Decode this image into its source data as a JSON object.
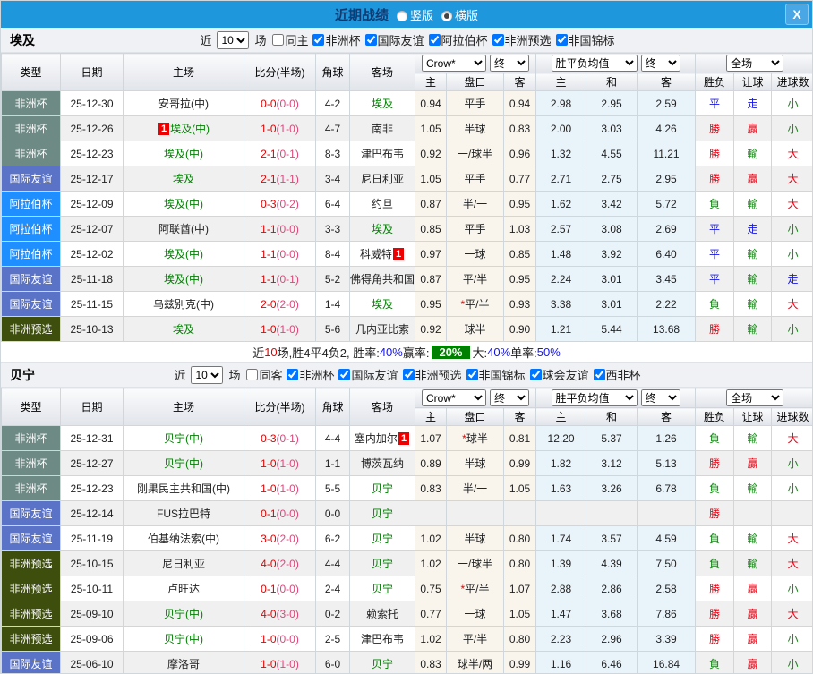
{
  "titlebar": {
    "title": "近期战绩",
    "radio_options": [
      {
        "label": "竖版",
        "selected": false
      },
      {
        "label": "横版",
        "selected": true
      }
    ],
    "close_label": "X"
  },
  "filter_words": {
    "near": "近",
    "count_selected": "10",
    "games": "场"
  },
  "columns": {
    "main": [
      "类型",
      "日期",
      "主场",
      "比分(半场)",
      "角球",
      "客场"
    ],
    "odds_select": "Crow*",
    "final_select": "终",
    "mean_select": "胜平负均值",
    "mean_final_select": "终",
    "fullmatch_select": "全场",
    "sub": [
      "主",
      "盘口",
      "客",
      "主",
      "和",
      "客",
      "胜负",
      "让球",
      "进球数"
    ]
  },
  "league_colors": {
    "非洲杯": "#6d8a85",
    "国际友谊": "#5a73c6",
    "阿拉伯杯": "#1f8fff",
    "非洲预选": "#3e4e0c"
  },
  "status_colors": {
    "red": "#e60012",
    "blue": "#1414e6",
    "green": "#168716",
    "score_full": "#e60000",
    "score_half": "#e0457b",
    "badge_bg": "#ee0000",
    "summary_badge_bg": "#008000",
    "titlebar_bg": "#1e97dc"
  },
  "teams": [
    {
      "key": "egypt",
      "name": "埃及",
      "same_label": "同主",
      "same_checked": false,
      "leagues": [
        {
          "label": "非洲杯",
          "checked": true
        },
        {
          "label": "国际友谊",
          "checked": true
        },
        {
          "label": "阿拉伯杯",
          "checked": true
        },
        {
          "label": "非洲预选",
          "checked": true
        },
        {
          "label": "非国锦标",
          "checked": true
        }
      ],
      "rows": [
        {
          "t": "非洲杯",
          "d": "25-12-30",
          "h": "安哥拉(中)",
          "hs": false,
          "sc": "0-0",
          "ht": "(0-0)",
          "cn": "4-2",
          "a": "埃及",
          "as": true,
          "o1": "0.94",
          "hc": "平手",
          "o2": "0.94",
          "m1": "2.98",
          "m2": "2.95",
          "m3": "2.59",
          "r1": [
            "平",
            "blue"
          ],
          "r2": [
            "走",
            "blue"
          ],
          "r3": [
            "小",
            "green"
          ]
        },
        {
          "t": "非洲杯",
          "d": "25-12-26",
          "h": "埃及(中)",
          "hs": true,
          "hb": "1",
          "sc": "1-0",
          "ht": "(1-0)",
          "cn": "4-7",
          "a": "南非",
          "as": false,
          "o1": "1.05",
          "hc": "半球",
          "o2": "0.83",
          "m1": "2.00",
          "m2": "3.03",
          "m3": "4.26",
          "r1": [
            "勝",
            "red"
          ],
          "r2": [
            "贏",
            "red"
          ],
          "r3": [
            "小",
            "green"
          ]
        },
        {
          "t": "非洲杯",
          "d": "25-12-23",
          "h": "埃及(中)",
          "hs": true,
          "sc": "2-1",
          "ht": "(0-1)",
          "cn": "8-3",
          "a": "津巴布韦",
          "as": false,
          "o1": "0.92",
          "hc": "一/球半",
          "o2": "0.96",
          "m1": "1.32",
          "m2": "4.55",
          "m3": "11.21",
          "r1": [
            "勝",
            "red"
          ],
          "r2": [
            "輸",
            "green"
          ],
          "r3": [
            "大",
            "red"
          ]
        },
        {
          "t": "国际友谊",
          "d": "25-12-17",
          "h": "埃及",
          "hs": true,
          "sc": "2-1",
          "ht": "(1-1)",
          "cn": "3-4",
          "a": "尼日利亚",
          "as": false,
          "o1": "1.05",
          "hc": "平手",
          "o2": "0.77",
          "m1": "2.71",
          "m2": "2.75",
          "m3": "2.95",
          "r1": [
            "勝",
            "red"
          ],
          "r2": [
            "贏",
            "red"
          ],
          "r3": [
            "大",
            "red"
          ]
        },
        {
          "t": "阿拉伯杯",
          "d": "25-12-09",
          "h": "埃及(中)",
          "hs": true,
          "sc": "0-3",
          "ht": "(0-2)",
          "cn": "6-4",
          "a": "约旦",
          "as": false,
          "o1": "0.87",
          "hc": "半/一",
          "o2": "0.95",
          "m1": "1.62",
          "m2": "3.42",
          "m3": "5.72",
          "r1": [
            "負",
            "green"
          ],
          "r2": [
            "輸",
            "green"
          ],
          "r3": [
            "大",
            "red"
          ]
        },
        {
          "t": "阿拉伯杯",
          "d": "25-12-07",
          "h": "阿联酋(中)",
          "hs": false,
          "sc": "1-1",
          "ht": "(0-0)",
          "cn": "3-3",
          "a": "埃及",
          "as": true,
          "o1": "0.85",
          "hc": "平手",
          "o2": "1.03",
          "m1": "2.57",
          "m2": "3.08",
          "m3": "2.69",
          "r1": [
            "平",
            "blue"
          ],
          "r2": [
            "走",
            "blue"
          ],
          "r3": [
            "小",
            "green"
          ]
        },
        {
          "t": "阿拉伯杯",
          "d": "25-12-02",
          "h": "埃及(中)",
          "hs": true,
          "sc": "1-1",
          "ht": "(0-0)",
          "cn": "8-4",
          "a": "科威特",
          "as": false,
          "ab": "1",
          "o1": "0.97",
          "hc": "一球",
          "o2": "0.85",
          "m1": "1.48",
          "m2": "3.92",
          "m3": "6.40",
          "r1": [
            "平",
            "blue"
          ],
          "r2": [
            "輸",
            "green"
          ],
          "r3": [
            "小",
            "green"
          ]
        },
        {
          "t": "国际友谊",
          "d": "25-11-18",
          "h": "埃及(中)",
          "hs": true,
          "sc": "1-1",
          "ht": "(0-1)",
          "cn": "5-2",
          "a": "佛得角共和国",
          "as": false,
          "o1": "0.87",
          "hc": "平/半",
          "o2": "0.95",
          "m1": "2.24",
          "m2": "3.01",
          "m3": "3.45",
          "r1": [
            "平",
            "blue"
          ],
          "r2": [
            "輸",
            "green"
          ],
          "r3": [
            "走",
            "blue"
          ]
        },
        {
          "t": "国际友谊",
          "d": "25-11-15",
          "h": "乌兹别克(中)",
          "hs": false,
          "sc": "2-0",
          "ht": "(2-0)",
          "cn": "1-4",
          "a": "埃及",
          "as": true,
          "o1": "0.95",
          "hc": "平/半",
          "st": true,
          "o2": "0.93",
          "m1": "3.38",
          "m2": "3.01",
          "m3": "2.22",
          "r1": [
            "負",
            "green"
          ],
          "r2": [
            "輸",
            "green"
          ],
          "r3": [
            "大",
            "red"
          ]
        },
        {
          "t": "非洲预选",
          "d": "25-10-13",
          "h": "埃及",
          "hs": true,
          "sc": "1-0",
          "ht": "(1-0)",
          "cn": "5-6",
          "a": "几内亚比索",
          "as": false,
          "o1": "0.92",
          "hc": "球半",
          "o2": "0.90",
          "m1": "1.21",
          "m2": "5.44",
          "m3": "13.68",
          "r1": [
            "勝",
            "red"
          ],
          "r2": [
            "輸",
            "green"
          ],
          "r3": [
            "小",
            "green"
          ]
        }
      ],
      "summary_parts": [
        [
          "近",
          "k"
        ],
        [
          "10",
          "red"
        ],
        [
          "场,胜4平4负2, 胜率:",
          "k"
        ],
        [
          "40%",
          "blue"
        ],
        [
          " 赢率:",
          "k"
        ],
        [
          "20%",
          "badge"
        ],
        [
          " 大:",
          "k"
        ],
        [
          "40%",
          "blue"
        ],
        [
          " 单率:",
          "k"
        ],
        [
          "50%",
          "blue"
        ]
      ]
    },
    {
      "key": "benin",
      "name": "贝宁",
      "same_label": "同客",
      "same_checked": false,
      "leagues": [
        {
          "label": "非洲杯",
          "checked": true
        },
        {
          "label": "国际友谊",
          "checked": true
        },
        {
          "label": "非洲预选",
          "checked": true
        },
        {
          "label": "非国锦标",
          "checked": true
        },
        {
          "label": "球会友谊",
          "checked": true
        },
        {
          "label": "西非杯",
          "checked": true
        }
      ],
      "rows": [
        {
          "t": "非洲杯",
          "d": "25-12-31",
          "h": "贝宁(中)",
          "hs": true,
          "sc": "0-3",
          "ht": "(0-1)",
          "cn": "4-4",
          "a": "塞内加尔",
          "as": false,
          "ab": "1",
          "o1": "1.07",
          "hc": "球半",
          "st": true,
          "o2": "0.81",
          "m1": "12.20",
          "m2": "5.37",
          "m3": "1.26",
          "r1": [
            "負",
            "green"
          ],
          "r2": [
            "輸",
            "green"
          ],
          "r3": [
            "大",
            "red"
          ]
        },
        {
          "t": "非洲杯",
          "d": "25-12-27",
          "h": "贝宁(中)",
          "hs": true,
          "sc": "1-0",
          "ht": "(1-0)",
          "cn": "1-1",
          "a": "博茨瓦纳",
          "as": false,
          "o1": "0.89",
          "hc": "半球",
          "o2": "0.99",
          "m1": "1.82",
          "m2": "3.12",
          "m3": "5.13",
          "r1": [
            "勝",
            "red"
          ],
          "r2": [
            "贏",
            "red"
          ],
          "r3": [
            "小",
            "green"
          ]
        },
        {
          "t": "非洲杯",
          "d": "25-12-23",
          "h": "刚果民主共和国(中)",
          "hs": false,
          "sc": "1-0",
          "ht": "(1-0)",
          "cn": "5-5",
          "a": "贝宁",
          "as": true,
          "o1": "0.83",
          "hc": "半/一",
          "o2": "1.05",
          "m1": "1.63",
          "m2": "3.26",
          "m3": "6.78",
          "r1": [
            "負",
            "green"
          ],
          "r2": [
            "輸",
            "green"
          ],
          "r3": [
            "小",
            "green"
          ]
        },
        {
          "t": "国际友谊",
          "d": "25-12-14",
          "h": "FUS拉巴特",
          "hs": false,
          "sc": "0-1",
          "ht": "(0-0)",
          "cn": "0-0",
          "a": "贝宁",
          "as": true,
          "o1": "",
          "hc": "",
          "o2": "",
          "m1": "",
          "m2": "",
          "m3": "",
          "r1": [
            "勝",
            "red"
          ],
          "r2": null,
          "r3": null
        },
        {
          "t": "国际友谊",
          "d": "25-11-19",
          "h": "伯基纳法索(中)",
          "hs": false,
          "sc": "3-0",
          "ht": "(2-0)",
          "cn": "6-2",
          "a": "贝宁",
          "as": true,
          "o1": "1.02",
          "hc": "半球",
          "o2": "0.80",
          "m1": "1.74",
          "m2": "3.57",
          "m3": "4.59",
          "r1": [
            "負",
            "green"
          ],
          "r2": [
            "輸",
            "green"
          ],
          "r3": [
            "大",
            "red"
          ]
        },
        {
          "t": "非洲预选",
          "d": "25-10-15",
          "h": "尼日利亚",
          "hs": false,
          "sc": "4-0",
          "ht": "(2-0)",
          "cn": "4-4",
          "a": "贝宁",
          "as": true,
          "o1": "1.02",
          "hc": "一/球半",
          "o2": "0.80",
          "m1": "1.39",
          "m2": "4.39",
          "m3": "7.50",
          "r1": [
            "負",
            "green"
          ],
          "r2": [
            "輸",
            "green"
          ],
          "r3": [
            "大",
            "red"
          ]
        },
        {
          "t": "非洲预选",
          "d": "25-10-11",
          "h": "卢旺达",
          "hs": false,
          "sc": "0-1",
          "ht": "(0-0)",
          "cn": "2-4",
          "a": "贝宁",
          "as": true,
          "o1": "0.75",
          "hc": "平/半",
          "st": true,
          "o2": "1.07",
          "m1": "2.88",
          "m2": "2.86",
          "m3": "2.58",
          "r1": [
            "勝",
            "red"
          ],
          "r2": [
            "贏",
            "red"
          ],
          "r3": [
            "小",
            "green"
          ]
        },
        {
          "t": "非洲预选",
          "d": "25-09-10",
          "h": "贝宁(中)",
          "hs": true,
          "sc": "4-0",
          "ht": "(3-0)",
          "cn": "0-2",
          "a": "赖索托",
          "as": false,
          "o1": "0.77",
          "hc": "一球",
          "o2": "1.05",
          "m1": "1.47",
          "m2": "3.68",
          "m3": "7.86",
          "r1": [
            "勝",
            "red"
          ],
          "r2": [
            "贏",
            "red"
          ],
          "r3": [
            "大",
            "red"
          ]
        },
        {
          "t": "非洲预选",
          "d": "25-09-06",
          "h": "贝宁(中)",
          "hs": true,
          "sc": "1-0",
          "ht": "(0-0)",
          "cn": "2-5",
          "a": "津巴布韦",
          "as": false,
          "o1": "1.02",
          "hc": "平/半",
          "o2": "0.80",
          "m1": "2.23",
          "m2": "2.96",
          "m3": "3.39",
          "r1": [
            "勝",
            "red"
          ],
          "r2": [
            "贏",
            "red"
          ],
          "r3": [
            "小",
            "green"
          ]
        },
        {
          "t": "国际友谊",
          "d": "25-06-10",
          "h": "摩洛哥",
          "hs": false,
          "sc": "1-0",
          "ht": "(1-0)",
          "cn": "6-0",
          "a": "贝宁",
          "as": true,
          "o1": "0.83",
          "hc": "球半/两",
          "o2": "0.99",
          "m1": "1.16",
          "m2": "6.46",
          "m3": "16.84",
          "r1": [
            "負",
            "green"
          ],
          "r2": [
            "贏",
            "red"
          ],
          "r3": [
            "小",
            "green"
          ]
        }
      ],
      "summary_parts": null
    }
  ]
}
